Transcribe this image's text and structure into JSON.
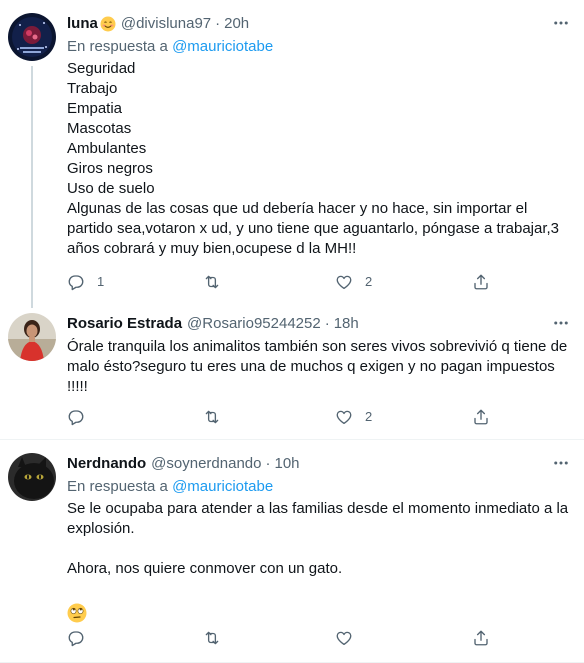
{
  "tweets": [
    {
      "name": "luna",
      "name_emoji": "smiling-face-emoji",
      "handle": "@divisluna97",
      "time": "20h",
      "reply_prefix": "En respuesta a",
      "reply_mention": "@mauriciotabe",
      "lines": [
        "Seguridad",
        "Trabajo",
        "Empatia",
        "Mascotas",
        "Ambulantes",
        "Giros negros",
        "Uso de suelo",
        "Algunas de las cosas que ud debería hacer y no hace, sin importar el",
        "partido sea,votaron x ud, y uno tiene que aguantarlo, póngase a trabajar,3",
        "años cobrará y muy bien,ocupese d la MH!!"
      ],
      "reply_count": "1",
      "retweet_count": "",
      "like_count": "2"
    },
    {
      "name": "Rosario Estrada",
      "handle": "@Rosario95244252",
      "time": "18h",
      "lines": [
        "Órale tranquila los animalitos también son seres vivos sobrevivió q tiene de",
        "malo ésto?seguro tu eres una de muchos q exigen y no pagan impuestos",
        "!!!!!"
      ],
      "reply_count": "",
      "retweet_count": "",
      "like_count": "2"
    },
    {
      "name": "Nerdnando",
      "handle": "@soynerdnando",
      "time": "10h",
      "reply_prefix": "En respuesta a",
      "reply_mention": "@mauriciotabe",
      "lines": [
        "Se le ocupaba para atender a las familias desde el momento inmediato a la",
        "explosión.",
        "",
        "Ahora, nos quiere conmover con un gato.",
        ""
      ],
      "end_emoji": "rolling-eyes-emoji",
      "reply_count": "",
      "retweet_count": "",
      "like_count": ""
    }
  ],
  "separator": "·",
  "colors": {
    "text": "#0f1419",
    "secondary": "#536471",
    "link": "#1d9bf0",
    "line": "#cfd9de",
    "divider": "#eff3f4"
  },
  "icons": [
    "reply-icon",
    "retweet-icon",
    "like-icon",
    "share-icon",
    "more-icon"
  ]
}
